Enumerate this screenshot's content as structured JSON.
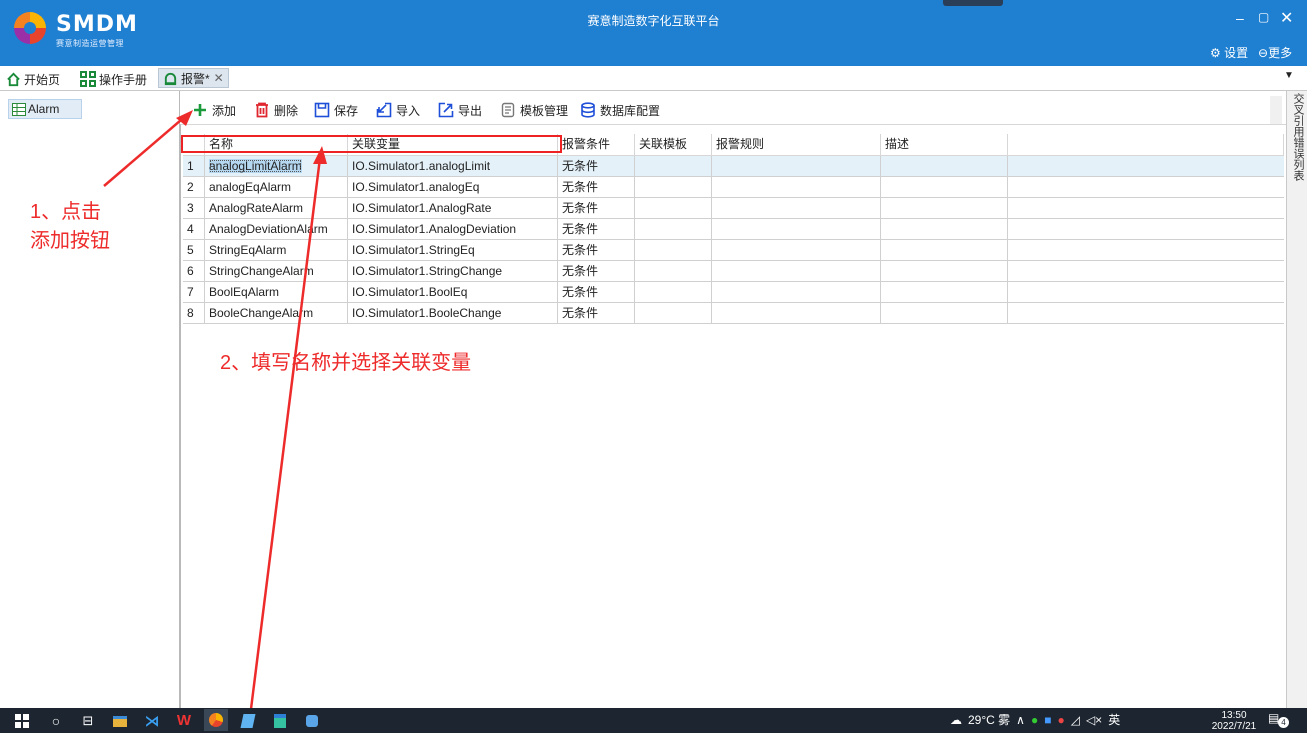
{
  "app": {
    "logo_text": "SMDM",
    "logo_subtitle": "赛意制造运营管理",
    "title": "赛意制造数字化互联平台",
    "settings_label": "设置",
    "more_label": "更多",
    "minimize": "–",
    "maximize": "▢",
    "close": "✕"
  },
  "tabs": [
    {
      "label": "开始页",
      "icon": "home-icon"
    },
    {
      "label": "操作手册",
      "icon": "grid-icon"
    },
    {
      "label": "报警*",
      "icon": "alarm-icon",
      "close": "✕",
      "active": true
    }
  ],
  "side_panel": {
    "items": [
      "交叉引用",
      "错误列表"
    ]
  },
  "tree": {
    "items": [
      {
        "label": "Alarm",
        "icon": "table-icon"
      }
    ]
  },
  "toolbar": {
    "add": "添加",
    "delete": "删除",
    "save": "保存",
    "import": "导入",
    "export": "导出",
    "template": "模板管理",
    "db_config": "数据库配置"
  },
  "table": {
    "columns": [
      "名称",
      "关联变量",
      "报警条件",
      "关联模板",
      "报警规则",
      "描述"
    ],
    "rows": [
      {
        "no": "1",
        "name": "analogLimitAlarm",
        "variable": "IO.Simulator1.analogLimit",
        "condition": "无条件"
      },
      {
        "no": "2",
        "name": "analogEqAlarm",
        "variable": "IO.Simulator1.analogEq",
        "condition": "无条件"
      },
      {
        "no": "3",
        "name": "AnalogRateAlarm",
        "variable": "IO.Simulator1.AnalogRate",
        "condition": "无条件"
      },
      {
        "no": "4",
        "name": "AnalogDeviationAlarm",
        "variable": "IO.Simulator1.AnalogDeviation",
        "condition": "无条件"
      },
      {
        "no": "5",
        "name": "StringEqAlarm",
        "variable": "IO.Simulator1.StringEq",
        "condition": "无条件"
      },
      {
        "no": "6",
        "name": "StringChangeAlarm",
        "variable": "IO.Simulator1.StringChange",
        "condition": "无条件"
      },
      {
        "no": "7",
        "name": "BoolEqAlarm",
        "variable": "IO.Simulator1.BoolEq",
        "condition": "无条件"
      },
      {
        "no": "8",
        "name": "BooleChangeAlarm",
        "variable": "IO.Simulator1.BooleChange",
        "condition": "无条件"
      }
    ]
  },
  "annotations": {
    "step1_line1": "1、点击",
    "step1_line2": "添加按钮",
    "step2": "2、填写名称并选择关联变量"
  },
  "taskbar": {
    "weather": "29°C 雾",
    "ime": "英",
    "time": "13:50",
    "date": "2022/7/21",
    "notifications": "4"
  },
  "colors": {
    "titlebar": "#1f7fd1",
    "annotation": "#ee2b2b",
    "taskbar": "#1d2630",
    "selected_row": "#e4f1f8",
    "selected_cell": "#b6d7f0"
  }
}
